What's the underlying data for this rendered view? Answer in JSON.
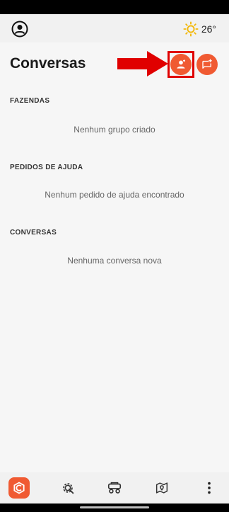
{
  "header": {
    "title": "Conversas",
    "add_contact_icon": "person-add-icon",
    "new_chat_icon": "chat-add-icon"
  },
  "top_bar": {
    "profile_icon": "account-circle-icon",
    "weather_icon": "sun-icon",
    "temperature": "26°"
  },
  "sections": [
    {
      "label": "FAZENDAS",
      "empty_text": "Nenhum grupo criado"
    },
    {
      "label": "PEDIDOS DE AJUDA",
      "empty_text": "Nenhum pedido de ajuda encontrado"
    },
    {
      "label": "CONVERSAS",
      "empty_text": "Nenhuma conversa nova"
    }
  ],
  "bottom_nav": {
    "items": [
      "home-logo-icon",
      "settings-gear-icon",
      "tractor-icon",
      "map-pin-icon",
      "more-vertical-icon"
    ]
  },
  "colors": {
    "accent": "#f05a32",
    "annotation": "#e00000",
    "background": "#f6f6f6"
  }
}
